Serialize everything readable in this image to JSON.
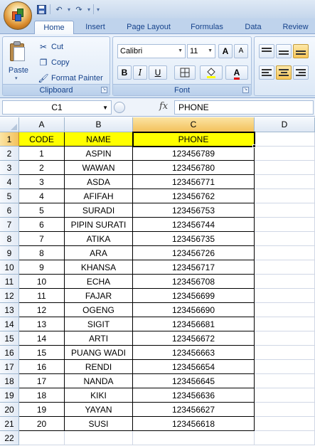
{
  "quick_access": {
    "items": [
      "save-icon",
      "undo-icon",
      "redo-icon"
    ]
  },
  "tabs": [
    "Home",
    "Insert",
    "Page Layout",
    "Formulas",
    "Data",
    "Review"
  ],
  "active_tab": "Home",
  "ribbon": {
    "clipboard": {
      "label": "Clipboard",
      "paste": "Paste",
      "cut": "Cut",
      "copy": "Copy",
      "format_painter": "Format Painter"
    },
    "font": {
      "label": "Font",
      "name": "Calibri",
      "size": "11",
      "bold": "B",
      "italic": "I",
      "underline": "U",
      "grow": "A",
      "shrink": "A",
      "color": "A"
    }
  },
  "formula_bar": {
    "name_box": "C1",
    "fx": "fx",
    "content": "PHONE"
  },
  "sheet": {
    "columns": [
      "A",
      "B",
      "C",
      "D"
    ],
    "selected_column": "C",
    "selected_row": "1",
    "header_row": [
      "CODE",
      "NAME",
      "PHONE"
    ],
    "row_numbers": [
      "1",
      "2",
      "3",
      "4",
      "5",
      "6",
      "7",
      "8",
      "9",
      "10",
      "11",
      "12",
      "13",
      "14",
      "15",
      "16",
      "17",
      "18",
      "19",
      "20",
      "21",
      "22"
    ],
    "rows": [
      [
        "1",
        "ASPIN",
        "123456789"
      ],
      [
        "2",
        "WAWAN",
        "123456780"
      ],
      [
        "3",
        "ASDA",
        "123456771"
      ],
      [
        "4",
        "AFIFAH",
        "123456762"
      ],
      [
        "5",
        "SURADI",
        "123456753"
      ],
      [
        "6",
        "PIPIN SURATI",
        "123456744"
      ],
      [
        "7",
        "ATIKA",
        "123456735"
      ],
      [
        "8",
        "ARA",
        "123456726"
      ],
      [
        "9",
        "KHANSA",
        "123456717"
      ],
      [
        "10",
        "ECHA",
        "123456708"
      ],
      [
        "11",
        "FAJAR",
        "123456699"
      ],
      [
        "12",
        "OGENG",
        "123456690"
      ],
      [
        "13",
        "SIGIT",
        "123456681"
      ],
      [
        "14",
        "ARTI",
        "123456672"
      ],
      [
        "15",
        "PUANG WADI",
        "123456663"
      ],
      [
        "16",
        "RENDI",
        "123456654"
      ],
      [
        "17",
        "NANDA",
        "123456645"
      ],
      [
        "18",
        "KIKI",
        "123456636"
      ],
      [
        "19",
        "YAYAN",
        "123456627"
      ],
      [
        "20",
        "SUSI",
        "123456618"
      ]
    ]
  },
  "colors": {
    "header_fill": "#ffff00",
    "selection_orange": "#f3c15b",
    "ribbon_blue": "#bfd3ec"
  }
}
